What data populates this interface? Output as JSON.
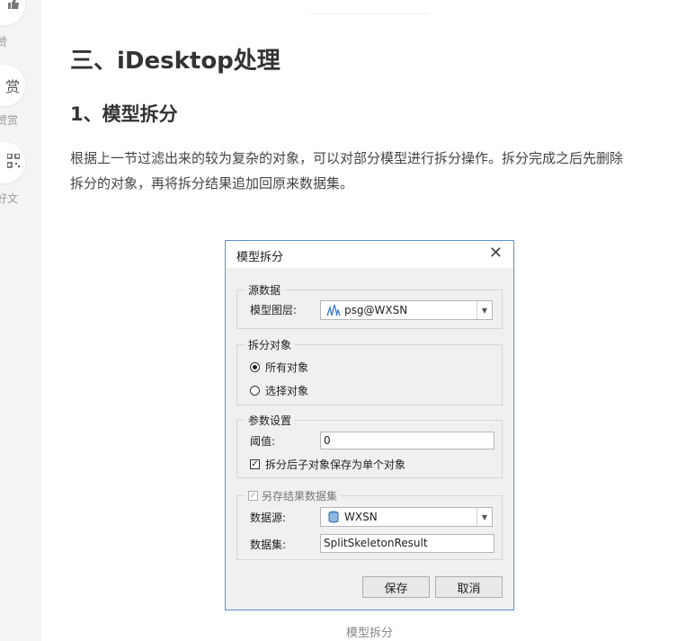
{
  "left_rail": {
    "like_label": "赞",
    "reward_glyph": "赏",
    "reward_label": "赞赏",
    "share_label": "好文"
  },
  "article": {
    "top_dots": "· ··",
    "section_heading": "三、iDesktop处理",
    "sub_heading": "1、模型拆分",
    "paragraph_line1": "根据上一节过滤出来的较为复杂的对象，可以对部分模型进行拆分操作。拆分完成之后先删除",
    "paragraph_line2": "拆分的对象，再将拆分结果追加回原来数据集。",
    "figure_caption": "模型拆分"
  },
  "dialog": {
    "title": "模型拆分",
    "close_glyph": "✕",
    "source_group": {
      "legend": "源数据",
      "layer_label": "模型图层:",
      "layer_value": "psg@WXSN"
    },
    "target_group": {
      "legend": "拆分对象",
      "options": [
        {
          "label": "所有对象",
          "selected": true
        },
        {
          "label": "选择对象",
          "selected": false
        }
      ]
    },
    "param_group": {
      "legend": "参数设置",
      "threshold_label": "阈值:",
      "threshold_value": "0",
      "save_single_label": "拆分后子对象保存为单个对象",
      "save_single_checked": true
    },
    "saveas_group": {
      "legend": "另存结果数据集",
      "enabled_checked": true,
      "datasource_label": "数据源:",
      "datasource_value": "WXSN",
      "dataset_label": "数据集:",
      "dataset_value": "SplitSkeletonResult"
    },
    "buttons": {
      "save": "保存",
      "cancel": "取消"
    }
  }
}
